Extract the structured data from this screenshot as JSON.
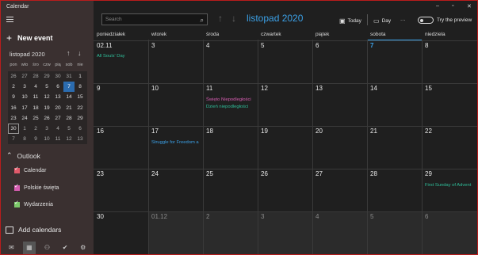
{
  "app": {
    "title": "Calendar"
  },
  "sidebar": {
    "new_event": "New event",
    "mini_calendar": {
      "month_label": "listopad 2020",
      "up": "↑",
      "down": "↓",
      "weekdays": [
        "pon",
        "wto",
        "śro",
        "czw",
        "pią",
        "sob",
        "nie"
      ],
      "days": [
        "26",
        "27",
        "28",
        "29",
        "30",
        "31",
        "1",
        "2",
        "3",
        "4",
        "5",
        "6",
        "7",
        "8",
        "9",
        "10",
        "11",
        "12",
        "13",
        "14",
        "15",
        "16",
        "17",
        "18",
        "19",
        "20",
        "21",
        "22",
        "23",
        "24",
        "25",
        "26",
        "27",
        "28",
        "29",
        "30",
        "1",
        "2",
        "3",
        "4",
        "5",
        "6",
        "7",
        "8",
        "9",
        "10",
        "11",
        "12",
        "13"
      ]
    },
    "outlook_label": "Outlook",
    "calendars": [
      {
        "name": "Calendar",
        "color": "#e05a6a"
      },
      {
        "name": "Polskie święta",
        "color": "#d65db1"
      },
      {
        "name": "Wydarzenia",
        "color": "#7cc96a"
      }
    ],
    "add_calendars": "Add calendars"
  },
  "toolbar": {
    "search_placeholder": "Search",
    "month_title": "listopad 2020",
    "today": "Today",
    "day": "Day",
    "more": "···",
    "preview": "Try the preview"
  },
  "calendar": {
    "weekdays": [
      "poniedziałek",
      "wtorek",
      "środa",
      "czwartek",
      "piątek",
      "sobota",
      "niedziela"
    ],
    "weeks": [
      [
        "02.11",
        "3",
        "4",
        "5",
        "6",
        "7",
        "8"
      ],
      [
        "9",
        "10",
        "11",
        "12",
        "13",
        "14",
        "15"
      ],
      [
        "16",
        "17",
        "18",
        "19",
        "20",
        "21",
        "22"
      ],
      [
        "23",
        "24",
        "25",
        "26",
        "27",
        "28",
        "29"
      ],
      [
        "30",
        "01.12",
        "2",
        "3",
        "4",
        "5",
        "6"
      ]
    ],
    "events": [
      {
        "text": "All Souls' Day",
        "color": "#2fbf9a"
      },
      {
        "text": "Święto Niepodległości",
        "color": "#d65db1"
      },
      {
        "text": "Dzień niepodległości",
        "color": "#2fbf9a"
      },
      {
        "text": "Struggle for Freedom a",
        "color": "#3ba0e6"
      },
      {
        "text": "First Sunday of Advent",
        "color": "#2fbf9a"
      }
    ]
  },
  "colors": {
    "accent": "#3ba0e6",
    "frame": "#b91c1c"
  }
}
